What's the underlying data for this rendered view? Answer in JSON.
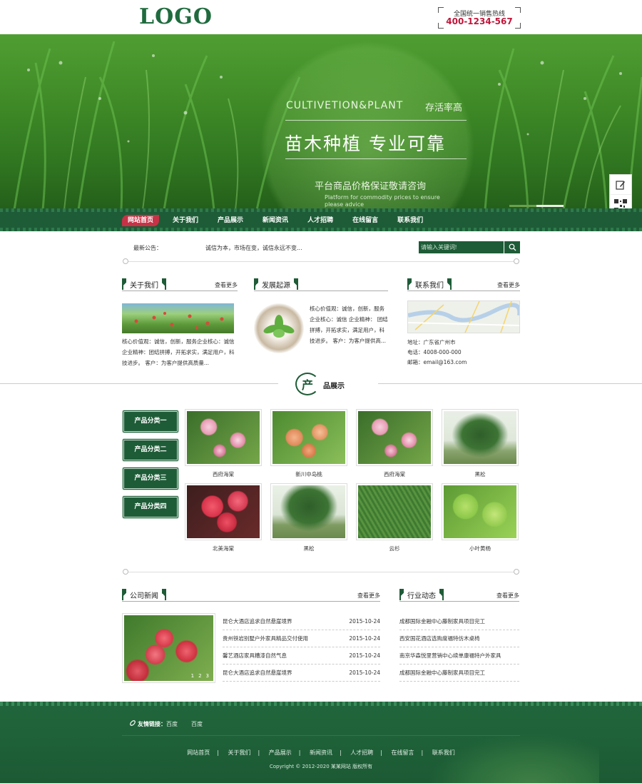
{
  "header": {
    "logo": "LOGO",
    "hotline_label": "全国统一销售热线",
    "hotline_number": "400-1234-567"
  },
  "banner": {
    "en_title": "CULTIVETION&PLANT",
    "en_tag": "存活率高",
    "title": "苗木种植  专业可靠",
    "subtitle": "平台商品价格保证敬请咨询",
    "subtitle_en": "Platform for commodity prices to ensure please advice"
  },
  "nav": {
    "items": [
      "网站首页",
      "关于我们",
      "产品展示",
      "新闻资讯",
      "人才招聘",
      "在线留言",
      "联系我们"
    ]
  },
  "notice": {
    "label": "最新公告：",
    "text": "诚信为本，市场在变，诚信永远不变..."
  },
  "search": {
    "placeholder": "请输入关键词!"
  },
  "about": {
    "title": "关于我们",
    "more": "查看更多",
    "text": "核心价值观：诚信，创新，服务企业核心：诚信 企业精神：团结拼搏，开拓求实，满足用户，科技进步。 客户：为客户提供高质量..."
  },
  "origin": {
    "title": "发展起源",
    "text": "核心价值观：诚信，创新，服务企业核心：诚信 企业精神： 团结拼搏，开拓求实，满足用户，科技进步。 客户：为客户提供高..."
  },
  "contact": {
    "title": "联系我们",
    "more": "查看更多",
    "address": "地址：广东省广州市",
    "phone": "电话：4008-000-000",
    "email": "邮箱：email@163.com"
  },
  "products": {
    "badge": "产",
    "title": "品展示",
    "categories": [
      "产品分类一",
      "产品分类二",
      "产品分类三",
      "产品分类四"
    ],
    "items": [
      {
        "name": "西府海棠"
      },
      {
        "name": "新川中岛桃"
      },
      {
        "name": "西府海棠"
      },
      {
        "name": "黑松"
      },
      {
        "name": "北美海棠"
      },
      {
        "name": "黑松"
      },
      {
        "name": "云杉"
      },
      {
        "name": "小叶黄杨"
      }
    ]
  },
  "company_news": {
    "title": "公司新闻",
    "more": "查看更多",
    "slide_pages": [
      "1",
      "2",
      "3"
    ],
    "items": [
      {
        "title": "昆仑大酒店追求自然悬崖境界",
        "date": "2015-10-24"
      },
      {
        "title": "贵州铁岩别墅户外家具精品交付使用",
        "date": "2015-10-24"
      },
      {
        "title": "馨艺酒店家具糟漆自然气息",
        "date": "2015-10-24"
      },
      {
        "title": "昆仑大酒店追求自然悬崖境界",
        "date": "2015-10-24"
      }
    ]
  },
  "industry_news": {
    "title": "行业动态",
    "more": "查看更多",
    "items": [
      "成都国际金融中心藤制家具项目完工",
      "西安国花酒店选购度福特仿木桌椅",
      "南京华森悦里营销中心续单康福特户外家具",
      "成都国际金融中心藤制家具项目完工"
    ]
  },
  "footer": {
    "links_label": "友情链接：",
    "links": [
      "百度",
      "百度"
    ],
    "nav": [
      "网站首页",
      "关于我们",
      "产品展示",
      "新闻资讯",
      "人才招聘",
      "在线留言",
      "联系我们"
    ],
    "copyright": "Copyright © 2012-2020 某某网站 版权所有"
  },
  "colors": {
    "brand_green": "#1e5c37",
    "nav_active": "#c73247",
    "hotline_red": "#c0163a"
  }
}
